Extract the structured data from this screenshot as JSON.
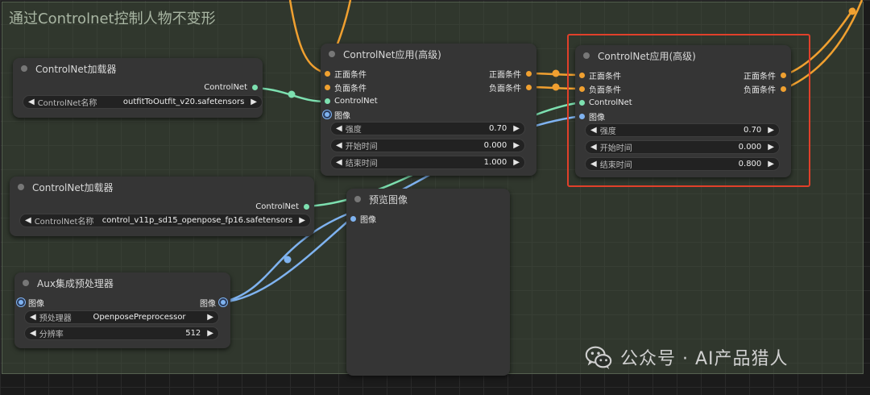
{
  "group": {
    "title": "通过Controlnet控制人物不变形"
  },
  "loader1": {
    "title": "ControlNet加载器",
    "output": "ControlNet",
    "widget_label": "ControlNet名称",
    "widget_value": "outfitToOutfit_v20.safetensors"
  },
  "loader2": {
    "title": "ControlNet加载器",
    "output": "ControlNet",
    "widget_label": "ControlNet名称",
    "widget_value": "control_v11p_sd15_openpose_fp16.safetensors"
  },
  "apply1": {
    "title": "ControlNet应用(高级)",
    "inputs": [
      "正面条件",
      "负面条件",
      "ControlNet",
      "图像"
    ],
    "outputs": [
      "正面条件",
      "负面条件"
    ],
    "widgets": [
      {
        "label": "强度",
        "value": "0.70"
      },
      {
        "label": "开始时间",
        "value": "0.000"
      },
      {
        "label": "结束时间",
        "value": "1.000"
      }
    ]
  },
  "apply2": {
    "title": "ControlNet应用(高级)",
    "inputs": [
      "正面条件",
      "负面条件",
      "ControlNet",
      "图像"
    ],
    "outputs": [
      "正面条件",
      "负面条件"
    ],
    "widgets": [
      {
        "label": "强度",
        "value": "0.70"
      },
      {
        "label": "开始时间",
        "value": "0.000"
      },
      {
        "label": "结束时间",
        "value": "0.800"
      }
    ]
  },
  "preview": {
    "title": "预览图像",
    "input": "图像"
  },
  "aux": {
    "title": "Aux集成预处理器",
    "input": "图像",
    "output": "图像",
    "widgets": [
      {
        "label": "预处理器",
        "value": "OpenposePreprocessor"
      },
      {
        "label": "分辨率",
        "value": "512"
      }
    ]
  },
  "watermark": {
    "text": "公众号 · AI产品猎人"
  },
  "colors": {
    "conditioning": "#f0a030",
    "controlnet": "#7de0b0",
    "image": "#7fb3f0",
    "highlight": "#e0402a"
  }
}
